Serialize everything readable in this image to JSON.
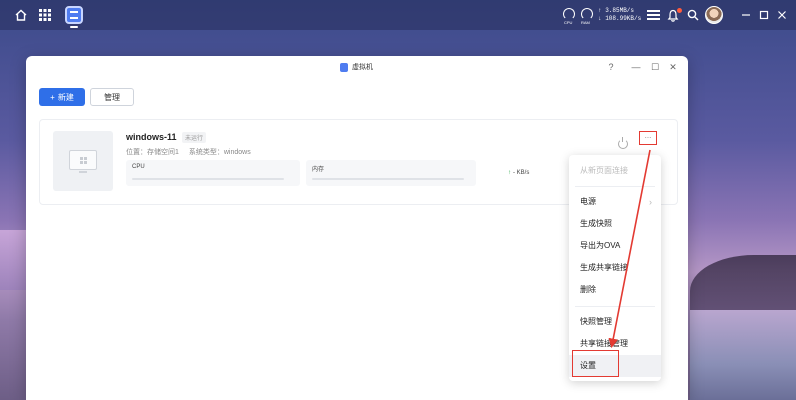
{
  "desktop": {
    "network": {
      "up": "↑ 3.85MB/s",
      "down": "↓ 108.99KB/s"
    },
    "gauges": [
      "CPU",
      "RAM"
    ]
  },
  "window": {
    "title": "虚拟机",
    "controls": {
      "help": "?",
      "minimize": "—",
      "maximize": "☐",
      "close": "✕"
    }
  },
  "toolbar": {
    "new_label": "新建",
    "new_icon": "+",
    "manage_label": "管理"
  },
  "vm": {
    "name": "windows-11",
    "status": "未运行",
    "location": "位置：存储空间1",
    "system_type": "系统类型：windows",
    "cpu_label": "CPU",
    "memory_label": "内存",
    "network_speed": "- KB/s",
    "more_label": "..."
  },
  "menu": {
    "items": [
      {
        "label": "从新页面连接",
        "disabled": true
      },
      {
        "label": "电源",
        "submenu": true
      },
      {
        "label": "生成快照"
      },
      {
        "label": "导出为OVA"
      },
      {
        "label": "生成共享链接"
      },
      {
        "label": "删除"
      },
      {
        "label": "快照管理"
      },
      {
        "label": "共享链接管理"
      },
      {
        "label": "设置"
      }
    ],
    "chevron": "›"
  },
  "colors": {
    "accent": "#2f6fe8",
    "annotation_red": "#e33a32",
    "net_up_green": "#2aa84a"
  }
}
